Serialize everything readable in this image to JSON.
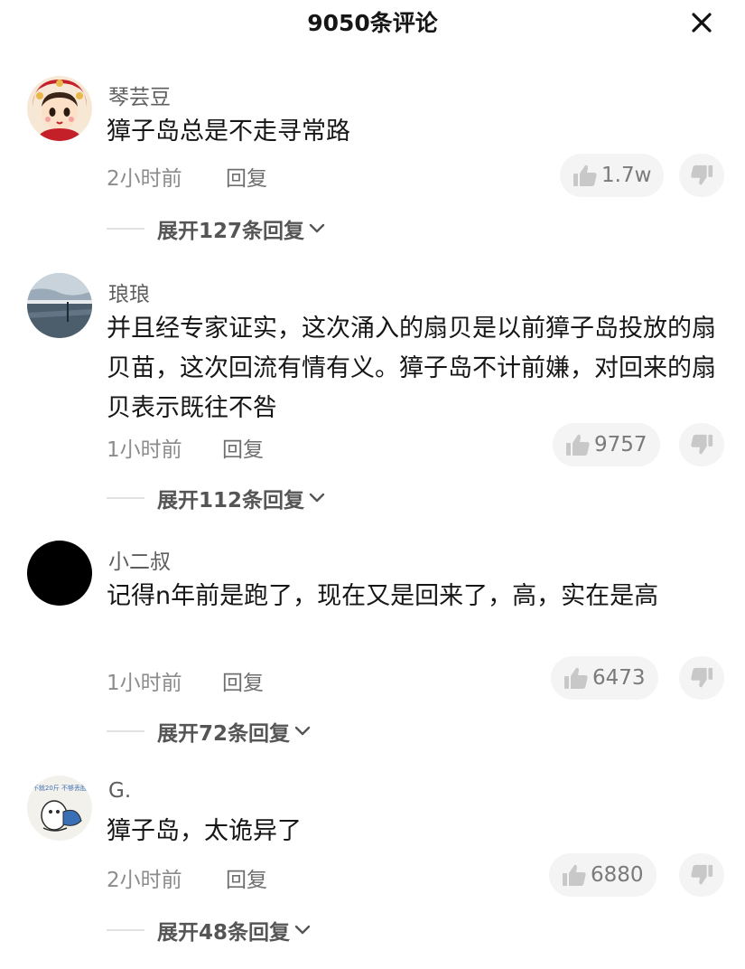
{
  "header": {
    "title": "9050条评论",
    "close_icon": "close-icon"
  },
  "colors": {
    "text": "#161616",
    "meta": "#8c8c8c",
    "pill_bg": "#f4f4f4"
  },
  "comments": [
    {
      "username": "琴芸豆",
      "content": "獐子岛总是不走寻常路",
      "time": "2小时前",
      "reply_label": "回复",
      "likes": "1.7w",
      "expand_label": "展开127条回复",
      "avatar_icon": "cartoon-girl-avatar"
    },
    {
      "username": "琅琅",
      "content": "并且经专家证实，这次涌入的扇贝是以前獐子岛投放的扇贝苗，这次回流有情有义。獐子岛不计前嫌，对回来的扇贝表示既往不咎",
      "time": "1小时前",
      "reply_label": "回复",
      "likes": "9757",
      "expand_label": "展开112条回复",
      "avatar_icon": "seascape-avatar"
    },
    {
      "username": "小二叔",
      "content": "记得n年前是跑了，现在又是回来了，高，实在是高",
      "time": "1小时前",
      "reply_label": "回复",
      "likes": "6473",
      "expand_label": "展开72条回复",
      "avatar_icon": "black-avatar"
    },
    {
      "username": "G.",
      "content": "獐子岛，太诡异了",
      "time": "2小时前",
      "reply_label": "回复",
      "likes": "6880",
      "expand_label": "展开48条回复",
      "avatar_icon": "cartoon-avatar",
      "avatar_text": "不就20斤 不够丢脸"
    }
  ]
}
